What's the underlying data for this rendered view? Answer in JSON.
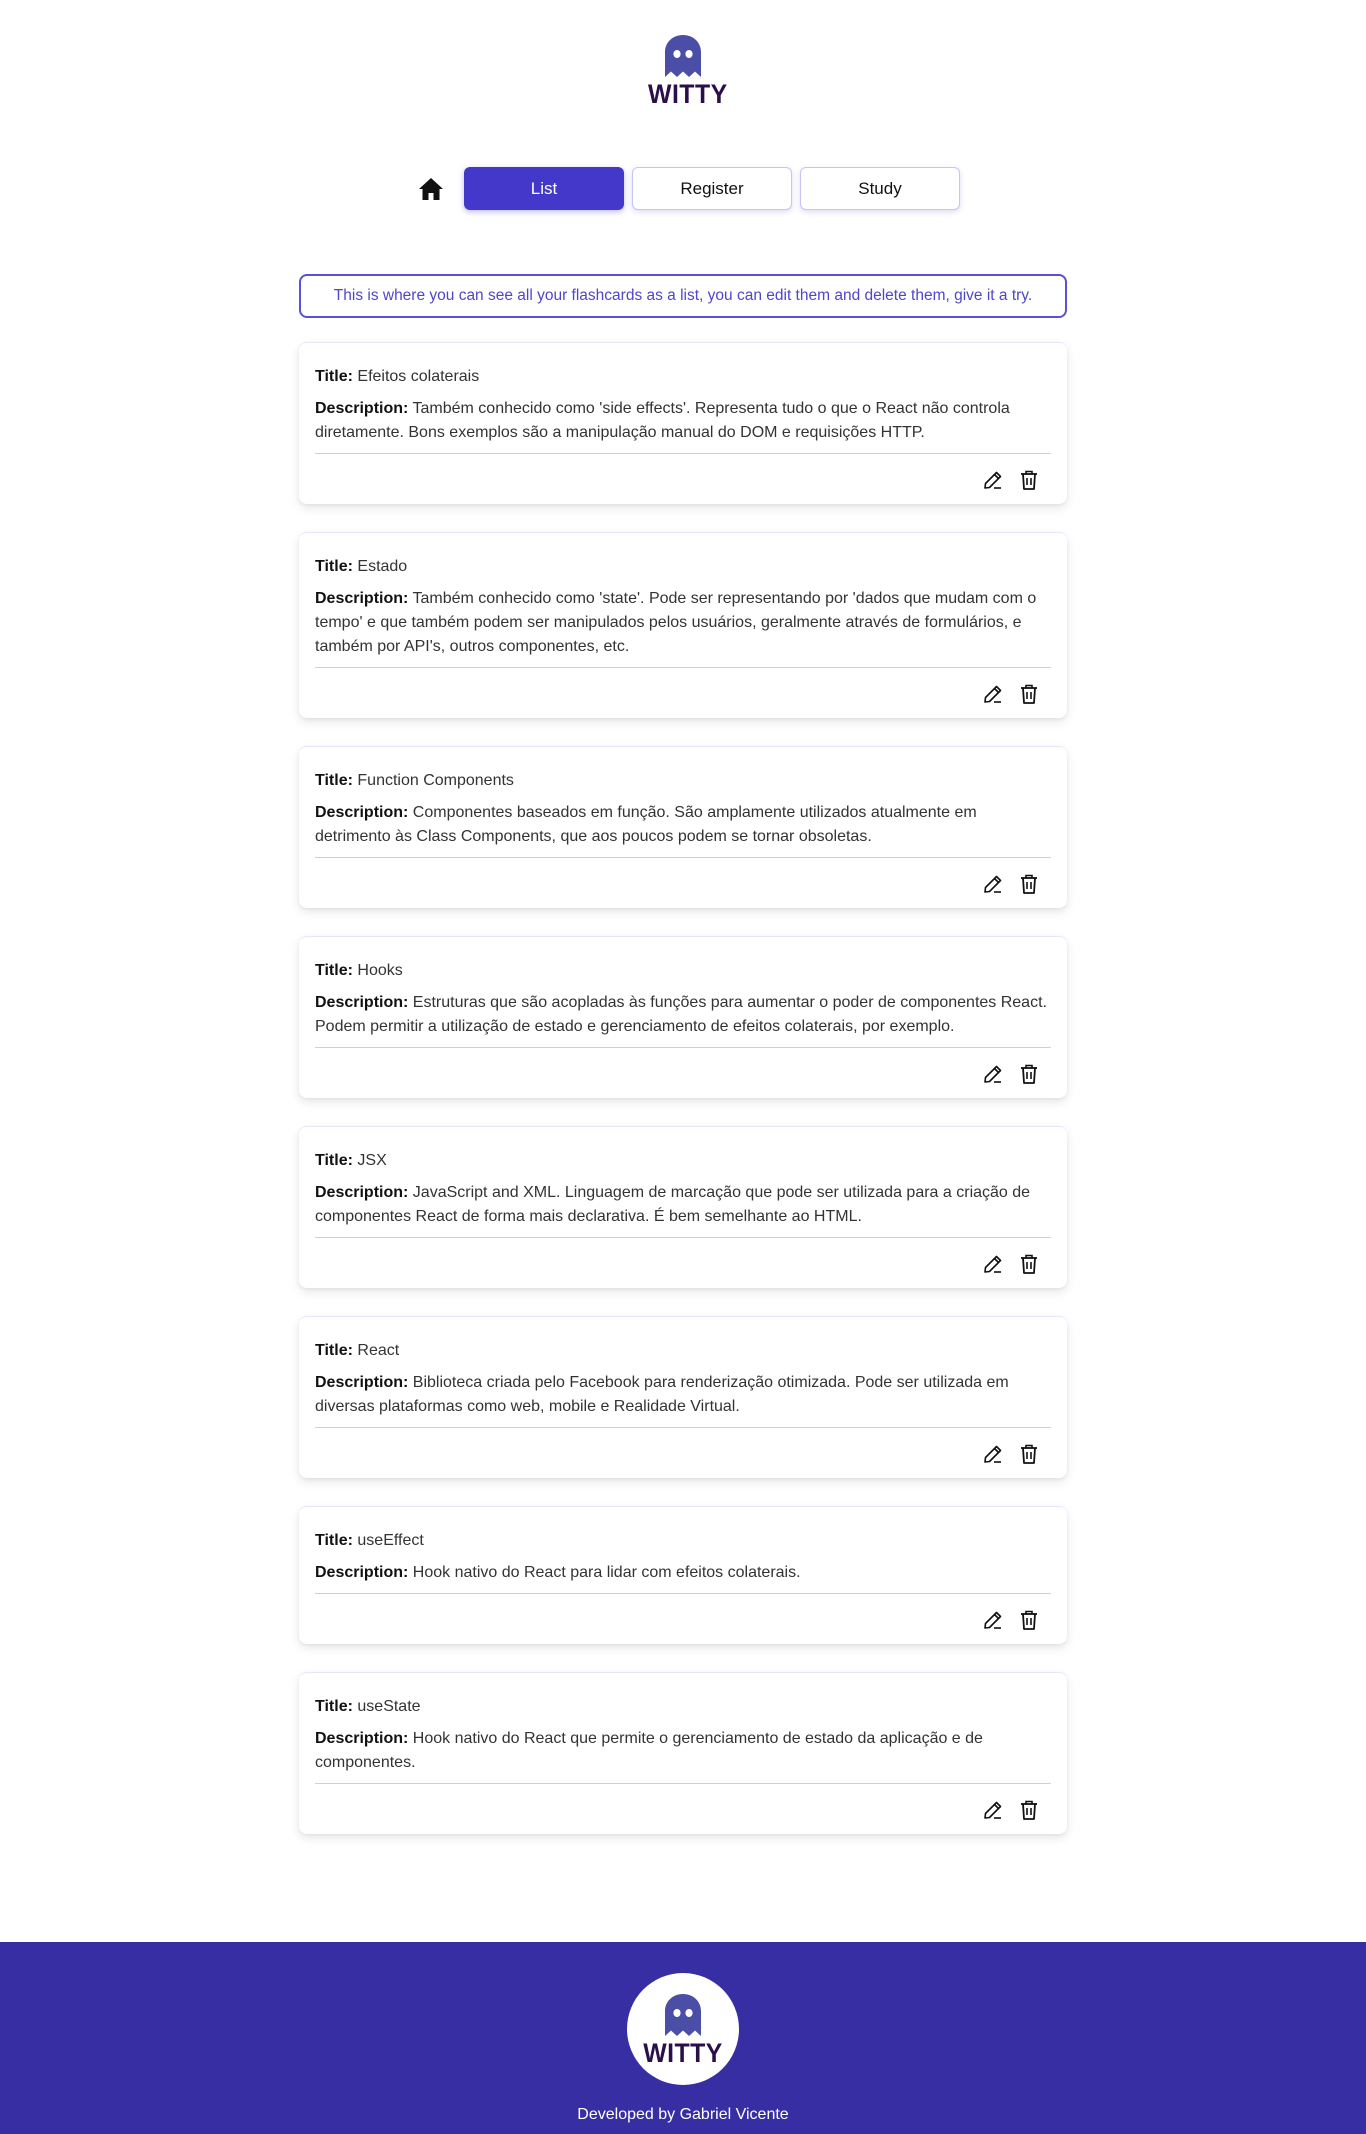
{
  "brand": {
    "name": "WITTY",
    "logo_icon": "ghost-icon",
    "color": "#2b0f4a",
    "ghost_color": "#4b4ea6"
  },
  "nav": {
    "home_icon": "home-icon",
    "items": [
      {
        "label": "List",
        "active": true
      },
      {
        "label": "Register",
        "active": false
      },
      {
        "label": "Study",
        "active": false
      }
    ]
  },
  "info": "This is where you can see all your flashcards as a list, you can edit them and delete them, give it a try.",
  "labels": {
    "title": "Title:",
    "description": "Description:"
  },
  "cards": [
    {
      "title": "Efeitos colaterais",
      "description": "Também conhecido como 'side effects'. Representa tudo o que o React não controla diretamente. Bons exemplos são a manipulação manual do DOM e requisições HTTP."
    },
    {
      "title": "Estado",
      "description": "Também conhecido como 'state'. Pode ser representando por 'dados que mudam com o tempo' e que também podem ser manipulados pelos usuários, geralmente através de formulários, e também por API's, outros componentes, etc."
    },
    {
      "title": "Function Components",
      "description": "Componentes baseados em função. São amplamente utilizados atualmente em detrimento às Class Components, que aos poucos podem se tornar obsoletas."
    },
    {
      "title": "Hooks",
      "description": "Estruturas que são acopladas às funções para aumentar o poder de componentes React. Podem permitir a utilização de estado e gerenciamento de efeitos colaterais, por exemplo."
    },
    {
      "title": "JSX",
      "description": "JavaScript and XML. Linguagem de marcação que pode ser utilizada para a criação de componentes React de forma mais declarativa. É bem semelhante ao HTML."
    },
    {
      "title": "React",
      "description": "Biblioteca criada pelo Facebook para renderização otimizada. Pode ser utilizada em diversas plataformas como web, mobile e Realidade Virtual."
    },
    {
      "title": "useEffect",
      "description": "Hook nativo do React para lidar com efeitos colaterais."
    },
    {
      "title": "useState",
      "description": "Hook nativo do React que permite o gerenciamento de estado da aplicação e de componentes."
    }
  ],
  "card_icons": {
    "edit": "pencil-icon",
    "delete": "trash-icon"
  },
  "footer": {
    "credit": "Developed by Gabriel Vicente",
    "background": "#372ea3"
  },
  "colors": {
    "accent": "#4338ca",
    "divider": "#a7e3d8"
  }
}
